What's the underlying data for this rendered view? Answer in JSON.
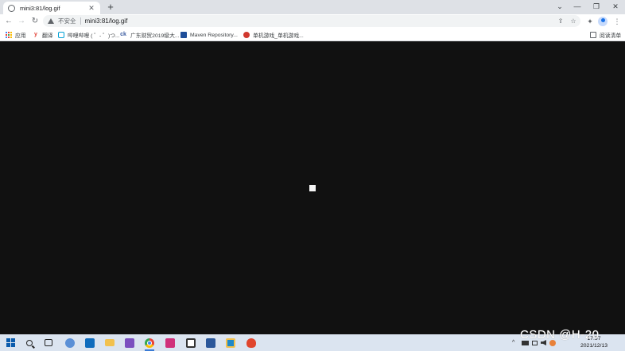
{
  "browser": {
    "tab": {
      "title": "mini3:81/log.gif",
      "close_glyph": "✕"
    },
    "new_tab_glyph": "+",
    "window_controls": {
      "tabsearch": "⌄",
      "minimize": "—",
      "maximize": "❐",
      "close": "✕"
    },
    "nav": {
      "back": "←",
      "forward": "→",
      "reload": "↻"
    },
    "omnibox": {
      "security_label": "不安全",
      "url": "mini3:81/log.gif",
      "share_glyph": "⇪",
      "star_glyph": "☆"
    },
    "toolbar_icons": {
      "extensions": "✦",
      "menu": "⋮"
    },
    "bookmarks": [
      {
        "label": "应用",
        "icon": "apps-grid-icon"
      },
      {
        "label": "翻译",
        "icon": "translate-icon",
        "color": "#e03c31"
      },
      {
        "label": "哔哩哔哩 ( ゜- ゜)つ...",
        "icon": "bilibili-icon",
        "color": "#00a1d6"
      },
      {
        "label": "广东财贸2019级大...",
        "icon": "ck-icon",
        "color": "#3a5ba0"
      },
      {
        "label": "Maven Repository...",
        "icon": "maven-icon",
        "color": "#1f4e99"
      },
      {
        "label": "单机游戏_单机游戏...",
        "icon": "game-icon",
        "color": "#d1392f"
      }
    ],
    "reading_list": {
      "label": "阅读清单",
      "icon": "reading-list-icon"
    }
  },
  "page": {
    "background": "#111111",
    "image_alt": "log.gif"
  },
  "taskbar": {
    "apps": [
      {
        "name": "start",
        "icon": "windows-start-icon"
      },
      {
        "name": "search",
        "icon": "search-icon"
      },
      {
        "name": "task-view",
        "icon": "task-view-icon"
      },
      {
        "name": "app-1",
        "icon": "settings-app-icon",
        "color": "#5a8fd6"
      },
      {
        "name": "mail",
        "icon": "mail-icon",
        "color": "#0f6cbd"
      },
      {
        "name": "explorer",
        "icon": "folder-icon",
        "color": "#f2c14e"
      },
      {
        "name": "visual-studio",
        "icon": "visual-studio-icon",
        "color": "#7b4fbf"
      },
      {
        "name": "chrome",
        "icon": "chrome-icon"
      },
      {
        "name": "intellij",
        "icon": "intellij-icon",
        "color": "#d0307a"
      },
      {
        "name": "panda-app",
        "icon": "panda-icon",
        "color": "#333333"
      },
      {
        "name": "word",
        "icon": "word-icon",
        "color": "#2b579a"
      },
      {
        "name": "app-2",
        "icon": "blue-square-app-icon",
        "color": "#1e88c8"
      },
      {
        "name": "app-3",
        "icon": "red-app-icon",
        "color": "#e0452d"
      }
    ],
    "clock": {
      "time": "17:57",
      "date": "2021/12/13"
    },
    "tray_glyph": "^"
  },
  "watermark": "CSDN @H-20"
}
